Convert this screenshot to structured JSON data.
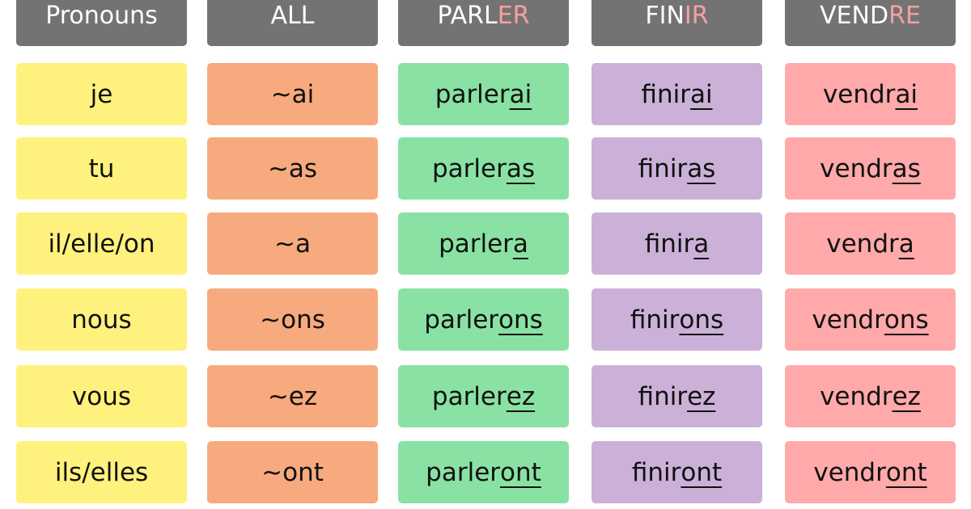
{
  "colors": {
    "header": "#737373",
    "header_highlight": "#f4a0a0",
    "pronouns": "#fff17d",
    "all": "#f7aa7e",
    "parler": "#89e2a3",
    "finir": "#cbb1d8",
    "vendre": "#ffa9aa"
  },
  "columns": [
    {
      "header": {
        "base": "Pronouns",
        "ending": ""
      },
      "color": "#fff17d",
      "cells": [
        {
          "stem": "je",
          "ending": ""
        },
        {
          "stem": "tu",
          "ending": ""
        },
        {
          "stem": "il/elle/on",
          "ending": ""
        },
        {
          "stem": "nous",
          "ending": ""
        },
        {
          "stem": "vous",
          "ending": ""
        },
        {
          "stem": "ils/elles",
          "ending": ""
        }
      ]
    },
    {
      "header": {
        "base": "ALL",
        "ending": ""
      },
      "color": "#f7aa7e",
      "cells": [
        {
          "stem": "~ai",
          "ending": ""
        },
        {
          "stem": "~as",
          "ending": ""
        },
        {
          "stem": "~a",
          "ending": ""
        },
        {
          "stem": "~ons",
          "ending": ""
        },
        {
          "stem": "~ez",
          "ending": ""
        },
        {
          "stem": "~ont",
          "ending": ""
        }
      ]
    },
    {
      "header": {
        "base": "PARL",
        "ending": "ER"
      },
      "color": "#89e2a3",
      "cells": [
        {
          "stem": "parler",
          "ending": "ai"
        },
        {
          "stem": "parler",
          "ending": "as"
        },
        {
          "stem": "parler",
          "ending": "a"
        },
        {
          "stem": "parler",
          "ending": "ons"
        },
        {
          "stem": "parler",
          "ending": "ez"
        },
        {
          "stem": "parler",
          "ending": "ont"
        }
      ]
    },
    {
      "header": {
        "base": "FIN",
        "ending": "IR"
      },
      "color": "#cbb1d8",
      "cells": [
        {
          "stem": "finir",
          "ending": "ai"
        },
        {
          "stem": "finir",
          "ending": "as"
        },
        {
          "stem": "finir",
          "ending": "a"
        },
        {
          "stem": "finir",
          "ending": "ons"
        },
        {
          "stem": "finir",
          "ending": "ez"
        },
        {
          "stem": "finir",
          "ending": "ont"
        }
      ]
    },
    {
      "header": {
        "base": "VEND",
        "ending": "RE"
      },
      "color": "#ffa9aa",
      "cells": [
        {
          "stem": "vendr",
          "ending": "ai"
        },
        {
          "stem": "vendr",
          "ending": "as"
        },
        {
          "stem": "vendr",
          "ending": "a"
        },
        {
          "stem": "vendr",
          "ending": "ons"
        },
        {
          "stem": "vendr",
          "ending": "ez"
        },
        {
          "stem": "vendr",
          "ending": "ont"
        }
      ]
    }
  ]
}
